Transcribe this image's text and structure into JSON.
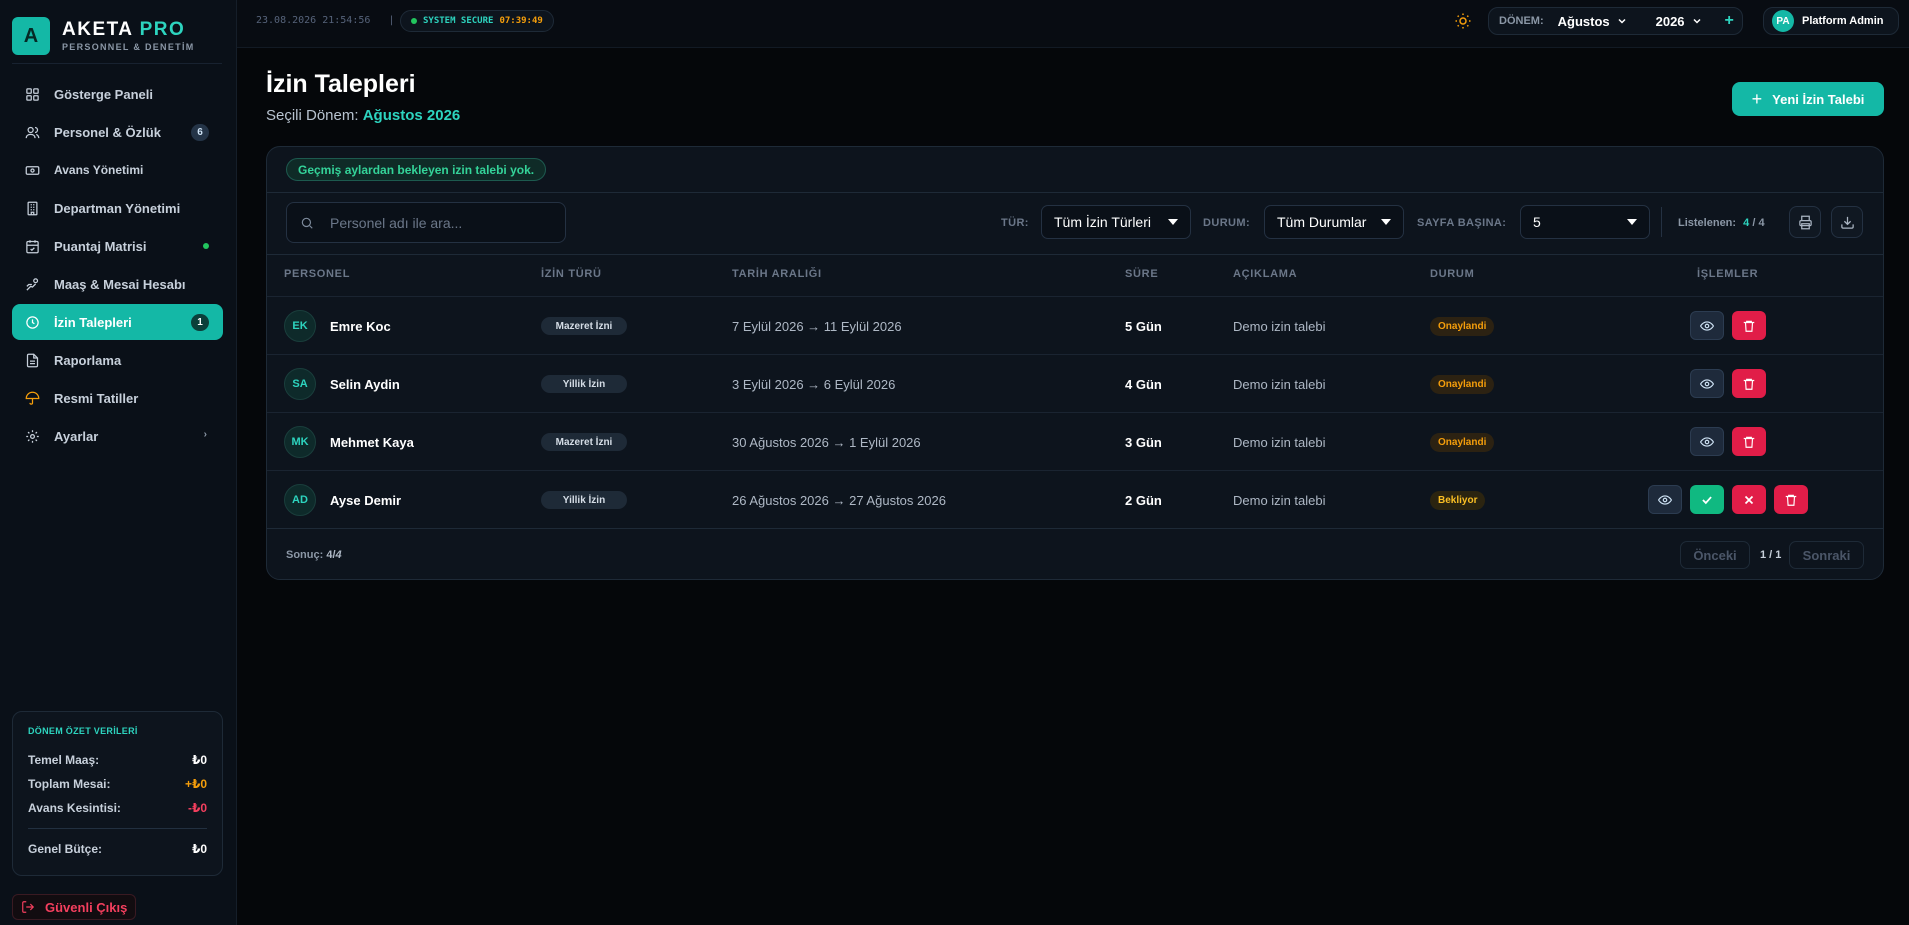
{
  "brand": {
    "letter": "A",
    "name_main": "AKETA",
    "name_accent": "PRO",
    "subtitle": "PERSONNEL & DENETİM"
  },
  "sidebar": {
    "items": [
      {
        "label": "Gösterge Paneli",
        "icon": "grid-icon"
      },
      {
        "label": "Personel & Özlük",
        "icon": "users-icon",
        "badge": "6"
      },
      {
        "label": "Avans Yönetimi",
        "icon": "banknote-icon"
      },
      {
        "label": "Departman Yönetimi",
        "icon": "building-icon"
      },
      {
        "label": "Puantaj Matrisi",
        "icon": "calendar-check-icon"
      },
      {
        "label": "Maaş & Mesai Hesabı",
        "icon": "hand-coins-icon"
      },
      {
        "label": "İzin Talepleri",
        "icon": "clock-icon",
        "badge": "1",
        "active": true
      },
      {
        "label": "Raporlama",
        "icon": "file-text-icon"
      },
      {
        "label": "Resmi Tatiller",
        "icon": "umbrella-icon"
      },
      {
        "label": "Ayarlar",
        "icon": "gear-icon",
        "chevron": "›"
      }
    ]
  },
  "summary": {
    "title": "DÖNEM ÖZET VERİLERİ",
    "rows": [
      {
        "label": "Temel Maaş:",
        "value": "₺0"
      },
      {
        "label": "Toplam Mesai:",
        "value": "+₺0"
      },
      {
        "label": "Avans Kesintisi:",
        "value": "-₺0"
      }
    ],
    "total_label": "Genel Bütçe:",
    "total_value": "₺0"
  },
  "logout_label": "Güvenli Çıkış",
  "topbar": {
    "datetime": "23.08.2026 21:54:56",
    "separator": "|",
    "secure_label": "SYSTEM SECURE",
    "secure_time": "07:39:49",
    "period_label": "DÖNEM:",
    "month": "Ağustos",
    "year": "2026",
    "plus": "+",
    "user_initials": "PA",
    "user_name": "Platform Admin"
  },
  "page": {
    "title": "İzin Talepleri",
    "subtitle_prefix": "Seçili Dönem:",
    "subtitle_value": "Ağustos 2026",
    "new_button": "Yeni İzin Talebi"
  },
  "notice": "Geçmiş aylardan bekleyen izin talebi yok.",
  "filters": {
    "search_placeholder": "Personel adı ile ara...",
    "type_label": "TÜR:",
    "type_value": "Tüm İzin Türleri",
    "status_label": "DURUM:",
    "status_value": "Tüm Durumlar",
    "page_size_label": "SAYFA BAŞINA:",
    "page_size_value": "5",
    "listed_label": "Listelenen:",
    "listed_count": "4",
    "listed_sep": "/",
    "listed_total": "4"
  },
  "table": {
    "headers": [
      "PERSONEL",
      "İZİN TÜRÜ",
      "TARİH ARALIĞI",
      "SÜRE",
      "AÇIKLAMA",
      "DURUM",
      "İŞLEMLER"
    ],
    "rows": [
      {
        "initials": "EK",
        "name": "Emre Koc",
        "type": "Mazeret İzni",
        "dates": "7 Eylül 2026 → 11 Eylül 2026",
        "duration": "5 Gün",
        "desc": "Demo izin talebi",
        "status": "Onaylandi",
        "pending": false
      },
      {
        "initials": "SA",
        "name": "Selin Aydin",
        "type": "Yillik İzin",
        "dates": "3 Eylül 2026 → 6 Eylül 2026",
        "duration": "4 Gün",
        "desc": "Demo izin talebi",
        "status": "Onaylandi",
        "pending": false
      },
      {
        "initials": "MK",
        "name": "Mehmet Kaya",
        "type": "Mazeret İzni",
        "dates": "30 Ağustos 2026 → 1 Eylül 2026",
        "duration": "3 Gün",
        "desc": "Demo izin talebi",
        "status": "Onaylandi",
        "pending": false
      },
      {
        "initials": "AD",
        "name": "Ayse Demir",
        "type": "Yillik İzin",
        "dates": "26 Ağustos 2026 → 27 Ağustos 2026",
        "duration": "2 Gün",
        "desc": "Demo izin talebi",
        "status": "Bekliyor",
        "pending": true
      }
    ]
  },
  "footer": {
    "result_label": "Sonuç:",
    "result_count": "4",
    "result_sep": "/",
    "result_total": "4",
    "prev": "Önceki",
    "page_info": "1 / 1",
    "next": "Sonraki"
  },
  "colors": {
    "accent": "#14b8a6",
    "warning": "#f59e0b",
    "danger": "#e11d48",
    "success": "#10b981"
  }
}
